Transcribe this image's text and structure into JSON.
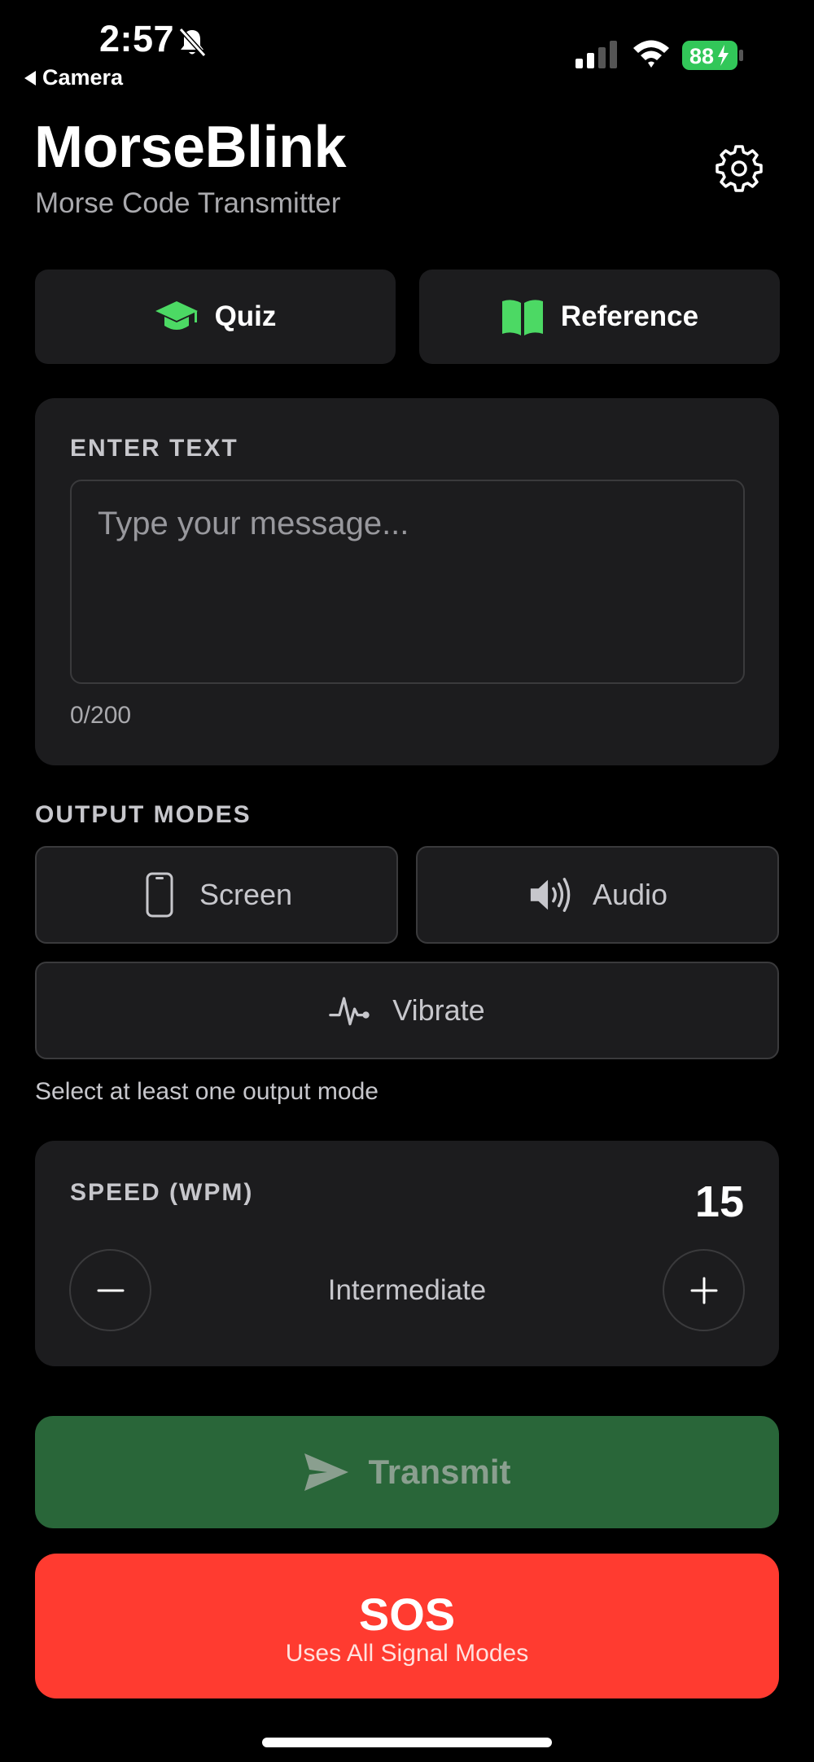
{
  "status_bar": {
    "time": "2:57",
    "back_label": "Camera",
    "battery": "88"
  },
  "header": {
    "title": "MorseBlink",
    "subtitle": "Morse Code Transmitter"
  },
  "nav": {
    "quiz_label": "Quiz",
    "reference_label": "Reference"
  },
  "text_input": {
    "section_label": "ENTER TEXT",
    "placeholder": "Type your message...",
    "value": "",
    "char_count": "0/200"
  },
  "output_modes": {
    "section_label": "OUTPUT MODES",
    "screen_label": "Screen",
    "audio_label": "Audio",
    "vibrate_label": "Vibrate",
    "hint": "Select at least one output mode"
  },
  "speed": {
    "label": "SPEED (WPM)",
    "value": "15",
    "level": "Intermediate"
  },
  "actions": {
    "transmit_label": "Transmit",
    "sos_label": "SOS",
    "sos_subtitle": "Uses All Signal Modes"
  },
  "colors": {
    "background": "#000000",
    "card": "#1c1c1e",
    "accent_green": "#4cd964",
    "transmit_bg": "#296639",
    "sos_red": "#ff3b30"
  }
}
